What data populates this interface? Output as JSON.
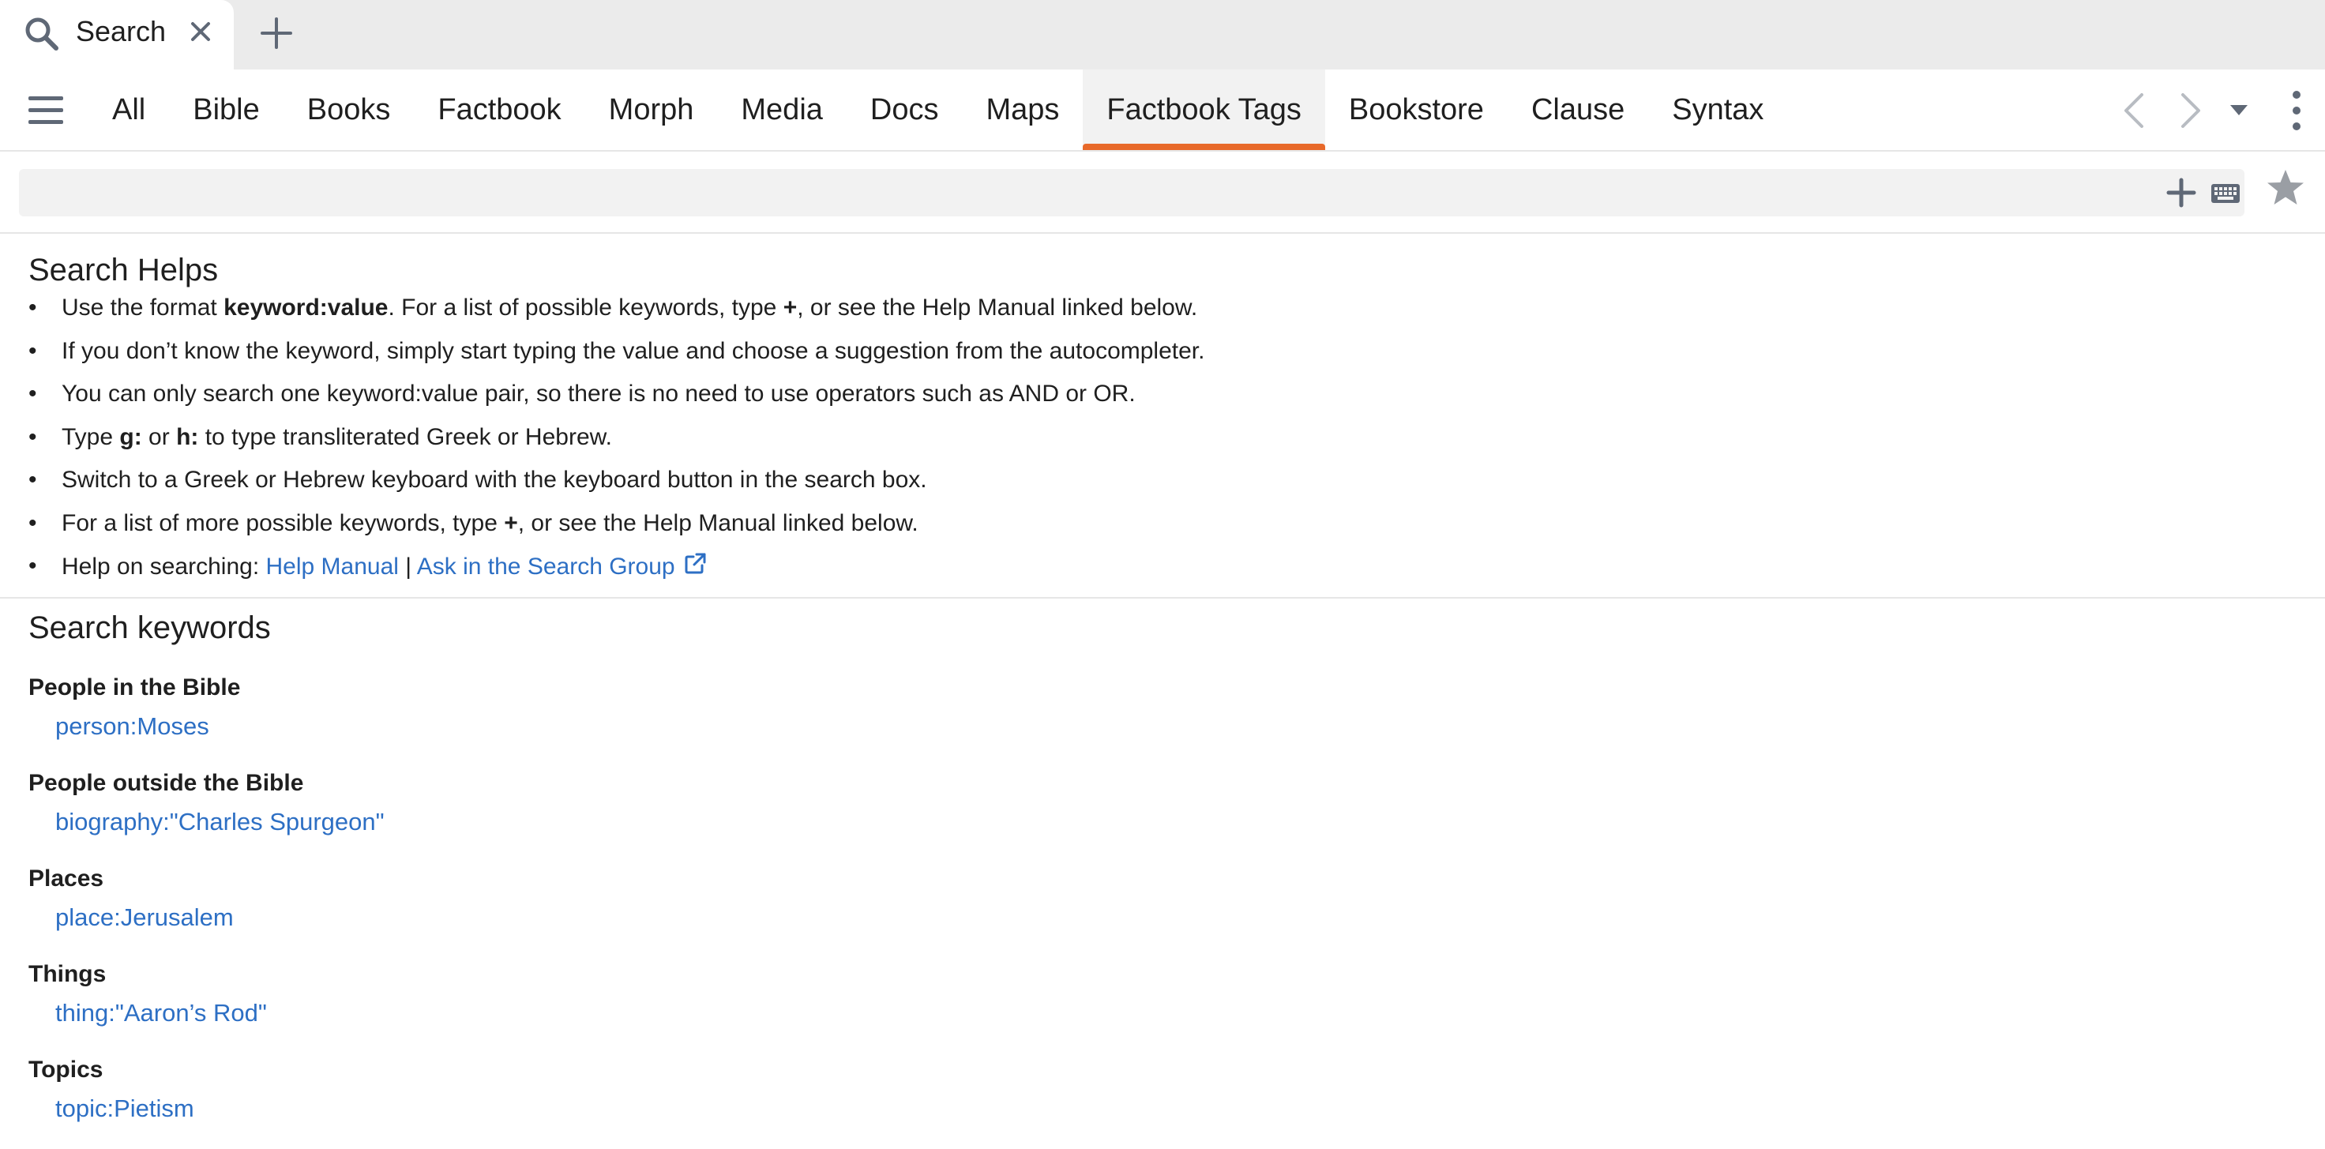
{
  "doc_tab": {
    "title": "Search",
    "icon": "search-icon",
    "close_icon": "close-icon"
  },
  "new_tab_icon": "plus-icon",
  "categories": {
    "items": [
      {
        "label": "All"
      },
      {
        "label": "Bible"
      },
      {
        "label": "Books"
      },
      {
        "label": "Factbook"
      },
      {
        "label": "Morph"
      },
      {
        "label": "Media"
      },
      {
        "label": "Docs"
      },
      {
        "label": "Maps"
      },
      {
        "label": "Factbook Tags",
        "active": true
      },
      {
        "label": "Bookstore"
      },
      {
        "label": "Clause"
      },
      {
        "label": "Syntax"
      }
    ],
    "active_label": "Factbook Tags"
  },
  "search": {
    "value": "",
    "placeholder": ""
  },
  "helps": {
    "title": "Search Helps",
    "item1": {
      "pre": "Use the format ",
      "bold": "keyword:value",
      "mid": ". For a list of possible keywords, type ",
      "bold2": "+",
      "post": ", or see the Help Manual linked below."
    },
    "item2": "If you don’t know the keyword, simply start typing the value and choose a suggestion from the autocompleter.",
    "item3": "You can only search one keyword:value pair, so there is no need to use operators such as AND or OR.",
    "item4": {
      "pre": "Type ",
      "bold1": "g:",
      "mid": " or ",
      "bold2": "h:",
      "post": " to type transliterated Greek or Hebrew."
    },
    "item5": "Switch to a Greek or Hebrew keyboard with the keyboard button in the search box.",
    "item6": {
      "pre": "For a list of more possible keywords, type ",
      "bold": "+",
      "post": ", or see the Help Manual linked below."
    },
    "item7": {
      "pre": "Help on searching: ",
      "link1": "Help Manual",
      "separator": " | ",
      "link2": "Ask in the Search Group"
    }
  },
  "keywords": {
    "title": "Search keywords",
    "groups": [
      {
        "heading": "People in the Bible",
        "example": "person:Moses"
      },
      {
        "heading": "People outside the Bible",
        "example": "biography:\"Charles Spurgeon\""
      },
      {
        "heading": "Places",
        "example": "place:Jerusalem"
      },
      {
        "heading": "Things",
        "example": "thing:\"Aaron’s Rod\""
      },
      {
        "heading": "Topics",
        "example": "topic:Pietism"
      }
    ]
  },
  "colors": {
    "accent": "#e8692a",
    "link": "#2d6fc4",
    "tabstrip_bg": "#ebebeb",
    "icon": "#5f6876"
  }
}
